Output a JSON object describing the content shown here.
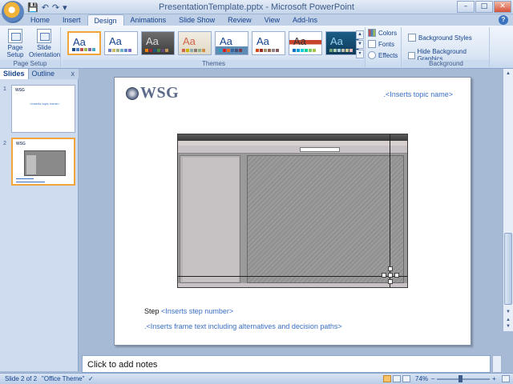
{
  "window": {
    "title": "PresentationTemplate.pptx - Microsoft PowerPoint",
    "controls": [
      "–",
      "□",
      "✕"
    ]
  },
  "qat": {
    "save_icon": "💾",
    "undo_icon": "↶",
    "redo_icon": "↷",
    "more_icon": "▾"
  },
  "tabs": [
    "Home",
    "Insert",
    "Design",
    "Animations",
    "Slide Show",
    "Review",
    "View",
    "Add-Ins"
  ],
  "help_label": "?",
  "ribbon": {
    "page_setup": {
      "page_setup_label": "Page Setup",
      "slide_orientation_label": "Slide Orientation",
      "group_label": "Page Setup"
    },
    "themes": {
      "group_label": "Themes",
      "thumb_label": "Aa",
      "scroll_up": "▲",
      "scroll_down": "▼",
      "more": "▾"
    },
    "theme_options": {
      "colors": "Colors",
      "fonts": "Fonts",
      "effects": "Effects"
    },
    "background": {
      "background_styles": "Background Styles",
      "hide_background_graphics": "Hide Background Graphics",
      "group_label": "Background"
    }
  },
  "left_pane": {
    "tab_slides": "Slides",
    "tab_outline": "Outline",
    "close": "x",
    "slide_numbers": [
      "1",
      "2"
    ],
    "thumb_topic": "<Inserts topic name>"
  },
  "slide": {
    "logo_text": "WSG",
    "topic": ".<Inserts topic name>",
    "step_label": "Step",
    "step_value": "<Inserts step number>",
    "frame_text": ".<Inserts frame text including alternatives and decision paths>"
  },
  "notes": {
    "placeholder": "Click to add notes"
  },
  "status": {
    "slide_info": "Slide 2 of 2",
    "theme": "\"Office Theme\"",
    "zoom": "74%",
    "zoom_minus": "–",
    "zoom_plus": "+"
  },
  "colors": {
    "accent": "#15428b",
    "selection": "#f1a53a",
    "placeholder_text": "#3a6fc4"
  }
}
